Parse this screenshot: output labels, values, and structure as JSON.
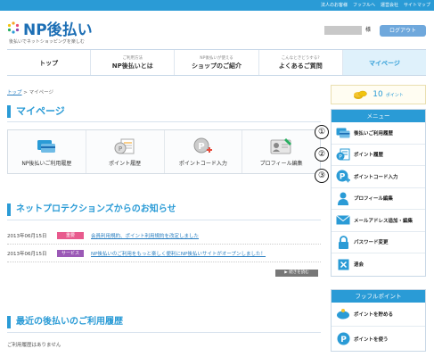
{
  "colors": {
    "accent": "#2a9bd6",
    "important_badge": "#e85a8d",
    "service_badge": "#9b59b6"
  },
  "header": {
    "top_links": [
      "法人のお客様",
      "フッフルへ",
      "運営会社",
      "サイトマップ"
    ],
    "logo_text": "NP後払い",
    "logo_sub": "後払いでネットショッピングを楽しむ",
    "user_suffix": "様",
    "logout_label": "ログアウト"
  },
  "gnav": [
    {
      "sub": "",
      "label": "トップ"
    },
    {
      "sub": "ご利用方法",
      "label": "NP後払いとは"
    },
    {
      "sub": "NP後払いが使える",
      "label": "ショップのご紹介"
    },
    {
      "sub": "こんなときどうする?",
      "label": "よくあるご質問"
    },
    {
      "sub": "",
      "label": "マイページ"
    }
  ],
  "breadcrumb": {
    "home": "トップ",
    "sep": " > ",
    "current": "マイページ"
  },
  "page_title": "マイページ",
  "quick_links": [
    {
      "label": "NP後払いご利用履歴",
      "icon": "card-icon"
    },
    {
      "label": "ポイント履歴",
      "icon": "points-history-icon"
    },
    {
      "label": "ポイントコード入力",
      "icon": "point-code-icon"
    },
    {
      "label": "プロフィール編集",
      "icon": "profile-icon"
    }
  ],
  "news": {
    "title": "ネットプロテクションズからのお知らせ",
    "items": [
      {
        "date": "2013年06月15日",
        "badge": "重要",
        "text": "会員利用規約、ポイント利用規約を改定しました"
      },
      {
        "date": "2013年06月15日",
        "badge": "サービス",
        "text": "NP後払いのご利用をもっと楽しく便利にNP後払いサイトがオープンしました！"
      }
    ],
    "more_label": "▶ 続きを読む"
  },
  "history": {
    "title": "最近の後払いのご利用履歴",
    "empty_text": "ご利用履歴はありません"
  },
  "points": {
    "value": "10",
    "unit": "ポイント"
  },
  "menu": {
    "header": "メニュー",
    "items": [
      {
        "label": "後払いご利用履歴",
        "icon": "card-icon",
        "marker": "①"
      },
      {
        "label": "ポイント履歴",
        "icon": "points-history-icon",
        "marker": "②"
      },
      {
        "label": "ポイントコード入力",
        "icon": "point-code-icon",
        "marker": "③"
      },
      {
        "label": "プロフィール編集",
        "icon": "user-icon",
        "marker": ""
      },
      {
        "label": "メールアドレス追加・編集",
        "icon": "mail-icon",
        "marker": ""
      },
      {
        "label": "パスワード変更",
        "icon": "lock-icon",
        "marker": ""
      },
      {
        "label": "退会",
        "icon": "exit-icon",
        "marker": ""
      }
    ]
  },
  "fuffle": {
    "header": "フッフルポイント",
    "items": [
      {
        "label": "ポイントを貯める",
        "icon": "piggy-icon"
      },
      {
        "label": "ポイントを使う",
        "icon": "use-point-icon"
      }
    ]
  }
}
